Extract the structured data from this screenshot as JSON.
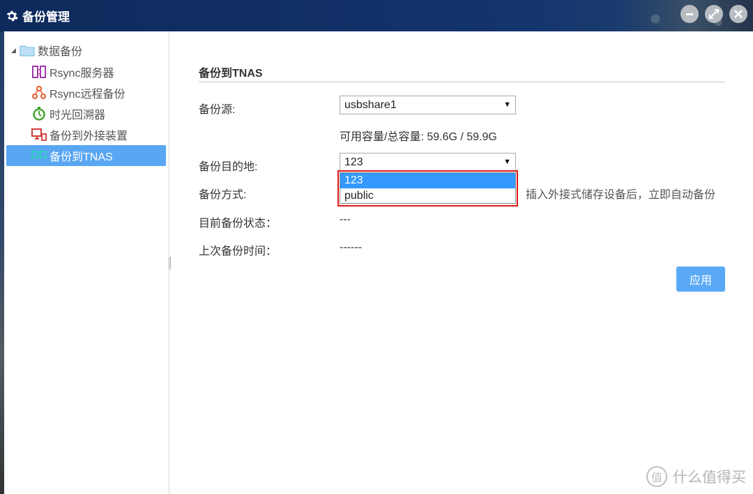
{
  "window": {
    "title": "备份管理",
    "controls": [
      "minimize-icon",
      "maximize-icon",
      "close-icon"
    ]
  },
  "sidebar": {
    "root_label": "数据备份",
    "items": [
      {
        "label": "Rsync服务器",
        "icon": "rsync-server-icon",
        "active": false
      },
      {
        "label": "Rsync远程备份",
        "icon": "rsync-remote-icon",
        "active": false
      },
      {
        "label": "时光回溯器",
        "icon": "time-machine-icon",
        "active": false
      },
      {
        "label": "备份到外接装置",
        "icon": "external-device-icon",
        "active": false
      },
      {
        "label": "备份到TNAS",
        "icon": "tnas-icon",
        "active": true
      }
    ]
  },
  "form": {
    "section_title": "备份到TNAS",
    "source_label": "备份源:",
    "source_value": "usbshare1",
    "capacity_text": "可用容量/总容量: 59.6G / 59.9G",
    "destination_label": "备份目的地:",
    "destination_value": "123",
    "destination_options": [
      "123",
      "public"
    ],
    "method_label": "备份方式:",
    "method_text": "插入外接式储存设备后，立即自动备份",
    "status_label": "目前备份状态：",
    "status_value": "---",
    "last_time_label": "上次备份时间：",
    "last_time_value": "------",
    "apply_label": "应用"
  },
  "watermark": {
    "icon_text": "值",
    "text": "什么值得买"
  },
  "colors": {
    "accent": "#59a7f3",
    "titlebar": "#14346d",
    "highlight_border": "#e01818",
    "option_selected": "#3399ff"
  }
}
